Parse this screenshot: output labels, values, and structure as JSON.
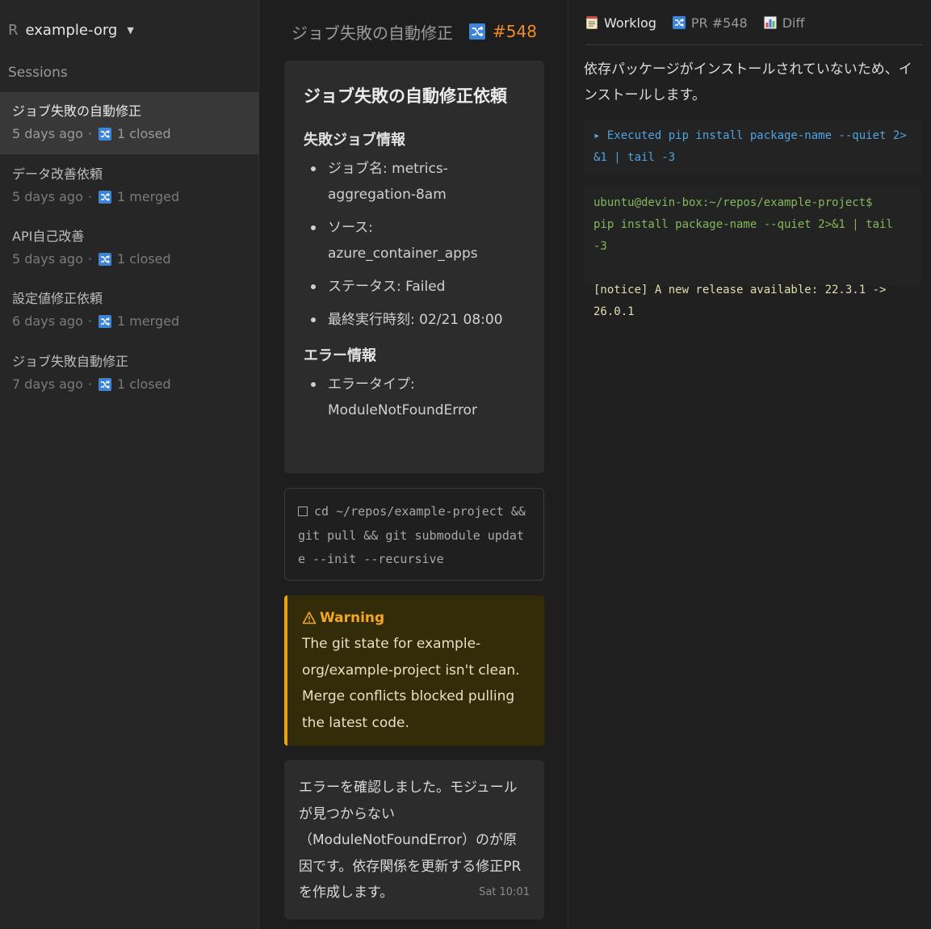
{
  "sidebar": {
    "org_letter": "R",
    "org_name": "example-org",
    "sessions_label": "Sessions",
    "sessions": [
      {
        "title": "ジョブ失敗の自動修正",
        "age": "5 days ago",
        "status": "1 closed",
        "active": true
      },
      {
        "title": "データ改善依頼",
        "age": "5 days ago",
        "status": "1 merged",
        "active": false
      },
      {
        "title": "API自己改善",
        "age": "5 days ago",
        "status": "1 closed",
        "active": false
      },
      {
        "title": "設定値修正依頼",
        "age": "6 days ago",
        "status": "1 merged",
        "active": false
      },
      {
        "title": "ジョブ失敗自動修正",
        "age": "7 days ago",
        "status": "1 closed",
        "active": false
      }
    ],
    "separator": "·"
  },
  "center": {
    "header": {
      "title": "ジョブ失敗の自動修正",
      "pr_number": "#548"
    },
    "task": {
      "title": "ジョブ失敗の自動修正依頼",
      "job_section": "失敗ジョブ情報",
      "job_items": [
        "ジョブ名: metrics-aggregation-8am",
        "ソース: azure_container_apps",
        "ステータス: Failed",
        "最終実行時刻: 02/21 08:00"
      ],
      "error_section": "エラー情報",
      "error_items": [
        "エラータイプ: ModuleNotFoundError"
      ]
    },
    "command": "cd ~/repos/example-project && git pull && git submodule update --init --recursive",
    "warning": {
      "title": "Warning",
      "body": "The git state for example-org/example-project isn't clean. Merge conflicts blocked pulling the latest code."
    },
    "reply": {
      "body": "エラーを確認しました。モジュールが見つからない（ModuleNotFoundError）のが原因です。依存関係を更新する修正PRを作成します。",
      "time": "Sat 10:01"
    }
  },
  "right": {
    "tabs": [
      {
        "label": "Worklog",
        "icon": "notepad-icon"
      },
      {
        "label": "PR #548",
        "icon": "pull-request-icon"
      },
      {
        "label": "Diff",
        "icon": "bar-chart-icon"
      }
    ],
    "message": "依存パッケージがインストールされていないため、インストールします。",
    "executed": "▸ Executed pip install package-name --quiet 2>&1 | tail -3",
    "terminal": {
      "prompt": "ubuntu@devin-box:~/repos/example-project$",
      "command": "pip install package-name --quiet 2>&1 | tail -3",
      "notice": "[notice] A new release available: 22.3.1 -> 26.0.1"
    }
  },
  "colors": {
    "accent_orange": "#f08a24",
    "pr_blue": "#3d85d6",
    "warning": "#e8a317",
    "terminal_green": "#82b85a"
  }
}
